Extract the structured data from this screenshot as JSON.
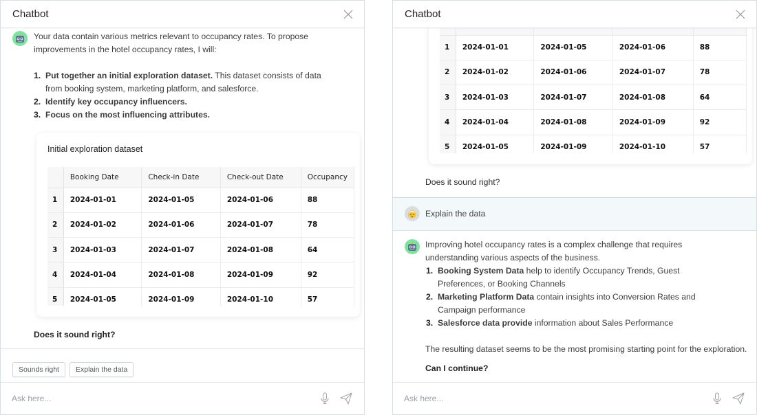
{
  "panels": [
    {
      "header": {
        "title": "Chatbot"
      },
      "bot_intro": {
        "text": "Your data contain various metrics relevant to occupancy rates. To propose improvements in the hotel occupancy rates, I will:",
        "steps": [
          {
            "num": "1.",
            "bold": "Put together an initial exploration dataset.",
            "rest": " This dataset consists of data from booking system, marketing platform, and salesforce."
          },
          {
            "num": "2.",
            "bold": "Identify key occupancy influencers.",
            "rest": ""
          },
          {
            "num": "3.",
            "bold": "Focus on the most influencing attributes.",
            "rest": ""
          }
        ]
      },
      "question": "Does it sound right?",
      "suggestions": [
        "Sounds right",
        "Explain the data"
      ],
      "input": {
        "placeholder": "Ask here..."
      }
    },
    {
      "header": {
        "title": "Chatbot"
      },
      "question": "Does it sound right?",
      "user_message": "Explain the data",
      "bot_reply": {
        "intro": "Improving hotel occupancy rates is a complex challenge that requires understanding various aspects of the business.",
        "points": [
          {
            "num": "1.",
            "bold": "Booking System Data",
            "rest": " help to identify Occupancy Trends, Guest Preferences, or Booking Channels"
          },
          {
            "num": "2.",
            "bold": "Marketing Platform Data",
            "rest": " contain insights into Conversion Rates and Campaign performance"
          },
          {
            "num": "3.",
            "bold": "Salesforce data provide",
            "rest": " information about Sales Performance"
          }
        ],
        "conclusion": "The resulting dataset seems to be the most promising starting point for the exploration.",
        "question": "Can I continue?"
      },
      "input": {
        "placeholder": "Ask here..."
      }
    }
  ],
  "dataset": {
    "title": "Initial exploration dataset",
    "columns": [
      "Booking Date",
      "Check-in Date",
      "Check-out Date",
      "Occupancy"
    ],
    "rows": [
      {
        "idx": "1",
        "cells": [
          "2024-01-01",
          "2024-01-05",
          "2024-01-06",
          "88"
        ]
      },
      {
        "idx": "2",
        "cells": [
          "2024-01-02",
          "2024-01-06",
          "2024-01-07",
          "78"
        ]
      },
      {
        "idx": "3",
        "cells": [
          "2024-01-03",
          "2024-01-07",
          "2024-01-08",
          "64"
        ]
      },
      {
        "idx": "4",
        "cells": [
          "2024-01-04",
          "2024-01-08",
          "2024-01-09",
          "92"
        ]
      },
      {
        "idx": "5",
        "cells": [
          "2024-01-05",
          "2024-01-09",
          "2024-01-10",
          "57"
        ]
      }
    ]
  },
  "icons": {
    "close": "close-icon",
    "bot_avatar": "robot-icon",
    "user_avatar": "person-icon",
    "mic": "microphone-icon",
    "send": "paper-plane-icon"
  },
  "colors": {
    "bot_avatar_bg": "#7fe3a0",
    "user_row_bg": "#f3f8fa",
    "border": "#e3e6ea"
  }
}
